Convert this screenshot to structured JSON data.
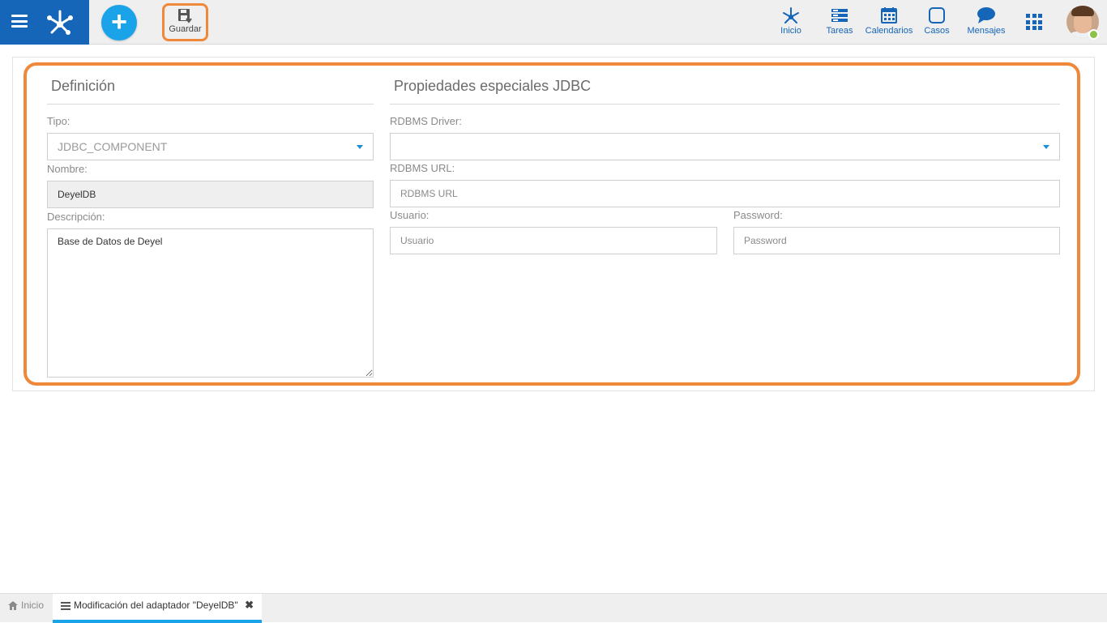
{
  "toolbar": {
    "save_label": "Guardar"
  },
  "nav": {
    "inicio": "Inicio",
    "tareas": "Tareas",
    "calendarios": "Calendarios",
    "casos": "Casos",
    "mensajes": "Mensajes"
  },
  "definition": {
    "title": "Definición",
    "tipo_label": "Tipo:",
    "tipo_value": "JDBC_COMPONENT",
    "nombre_label": "Nombre:",
    "nombre_value": "DeyelDB",
    "descripcion_label": "Descripción:",
    "descripcion_value": "Base de Datos de Deyel"
  },
  "jdbc": {
    "title": "Propiedades especiales JDBC",
    "driver_label": "RDBMS Driver:",
    "driver_value": "",
    "url_label": "RDBMS URL:",
    "url_placeholder": "RDBMS URL",
    "usuario_label": "Usuario:",
    "usuario_placeholder": "Usuario",
    "password_label": "Password:",
    "password_placeholder": "Password"
  },
  "tabs": {
    "home": "Inicio",
    "active": "Modificación del adaptador \"DeyelDB\""
  },
  "colors": {
    "brand": "#1565b8",
    "accent": "#1aa3e8",
    "highlight": "#f0883a",
    "online": "#8bc34a"
  }
}
